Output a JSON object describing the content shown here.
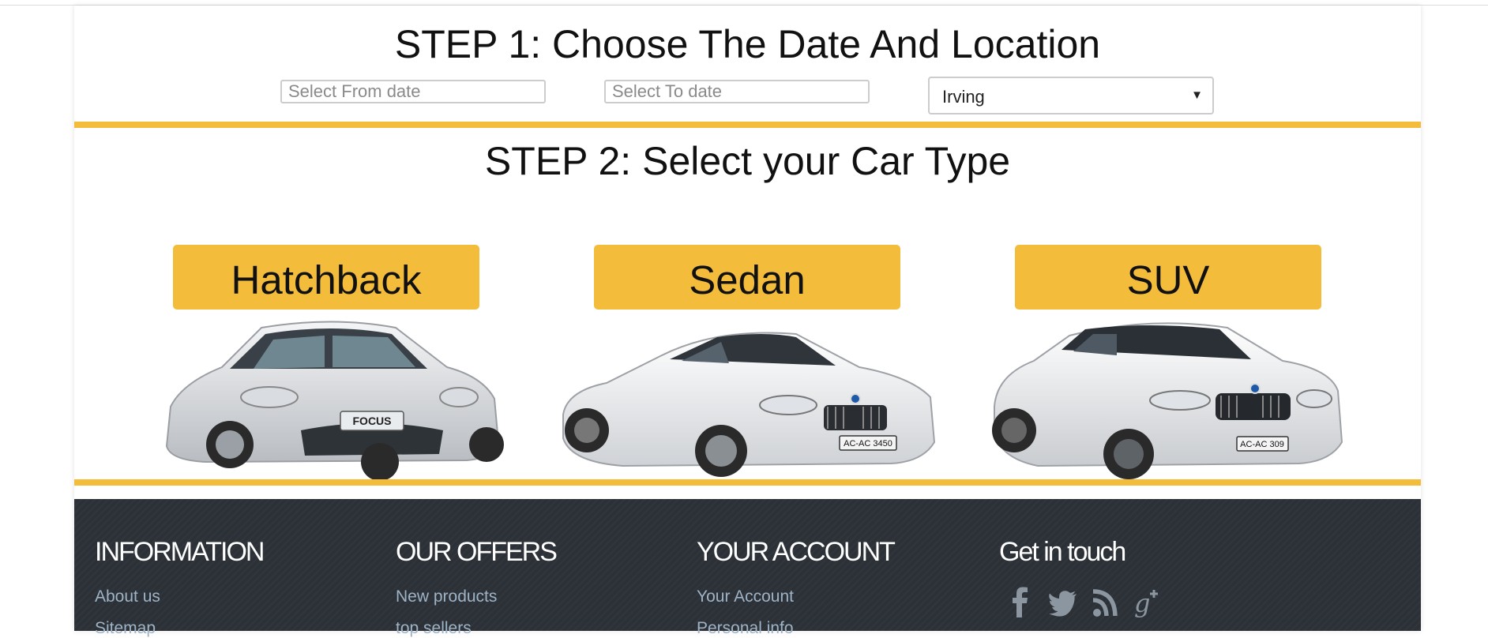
{
  "step1": {
    "title": "STEP 1: Choose The Date And Location",
    "from_placeholder": "Select From date",
    "to_placeholder": "Select To date",
    "location_value": "Irving"
  },
  "step2": {
    "title": "STEP 2: Select your Car Type",
    "cars": [
      {
        "label": "Hatchback",
        "badge": "FOCUS"
      },
      {
        "label": "Sedan",
        "plate": "AC-AC 3450"
      },
      {
        "label": "SUV",
        "plate": "AC-AC 309"
      }
    ]
  },
  "footer": {
    "information": {
      "heading": "INFORMATION",
      "links": [
        "About us",
        "Sitemap"
      ]
    },
    "offers": {
      "heading": "OUR OFFERS",
      "links": [
        "New products",
        "top sellers"
      ]
    },
    "account": {
      "heading": "YOUR ACCOUNT",
      "links": [
        "Your Account",
        "Personal info"
      ]
    },
    "contact": {
      "heading": "Get in touch",
      "icons": [
        "facebook-icon",
        "twitter-icon",
        "rss-icon",
        "google-plus-icon"
      ]
    }
  },
  "colors": {
    "accent": "#f4bc3b",
    "footer_bg": "#2b3137",
    "footer_link": "#9fb3c6"
  }
}
